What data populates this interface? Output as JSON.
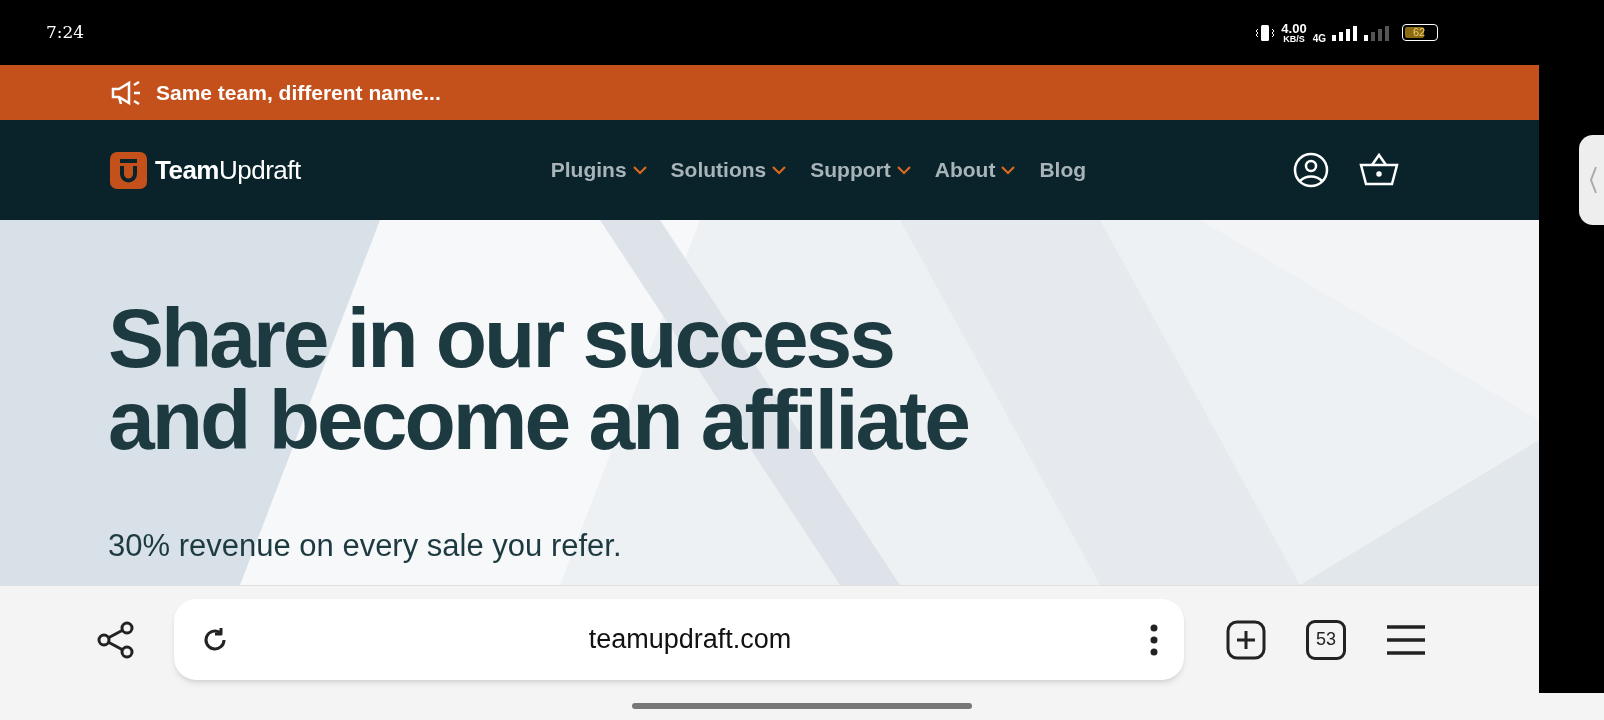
{
  "status_bar": {
    "time": "7:24",
    "speed": "4.00",
    "speed_unit": "KB/S",
    "network": "4G",
    "battery": "62"
  },
  "announcement": {
    "text": "Same team, different name..."
  },
  "nav": {
    "logo": "**Team**Updraft",
    "items": [
      {
        "label": "Plugins",
        "dropdown": true
      },
      {
        "label": "Solutions",
        "dropdown": true
      },
      {
        "label": "Support",
        "dropdown": true
      },
      {
        "label": "About",
        "dropdown": true
      },
      {
        "label": "Blog",
        "dropdown": false
      }
    ]
  },
  "hero": {
    "title_lines": [
      "Share in our success",
      "and become an affiliate"
    ],
    "subtitle": "30% revenue on every sale you refer."
  },
  "browser_bar": {
    "url": "teamupdraft.com",
    "tab_count": "53"
  }
}
